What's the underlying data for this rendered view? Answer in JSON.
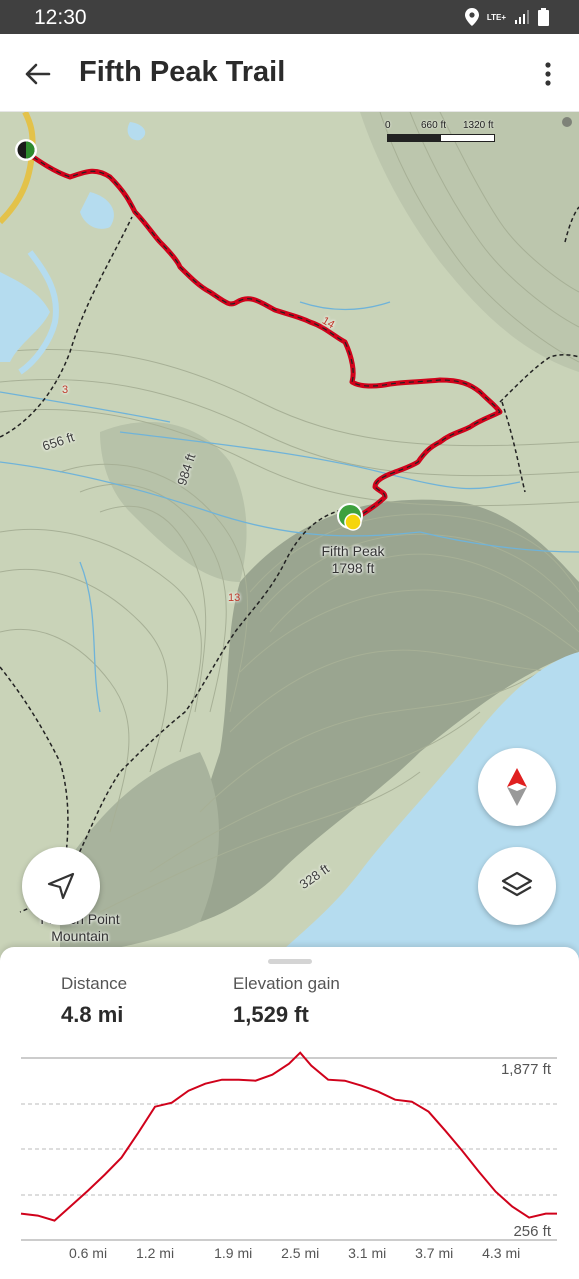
{
  "status_bar": {
    "time": "12:30",
    "network": "LTE+"
  },
  "app_bar": {
    "title": "Fifth Peak Trail"
  },
  "map": {
    "scale": {
      "zero": "0",
      "mid": "660 ft",
      "end": "1320 ft"
    },
    "peak": {
      "name": "Fifth Peak",
      "elevation": "1798 ft"
    },
    "place": {
      "name": "French Point Mountain"
    },
    "contour_labels": [
      "656 ft",
      "984 ft",
      "328 ft"
    ],
    "trail_numbers": [
      "3",
      "14",
      "13"
    ],
    "colors": {
      "trail": "#d0021b",
      "water": "#b5dcef",
      "terrain": "#c8d2b6"
    }
  },
  "stats": [
    {
      "label": "Distance",
      "value": "4.8 mi"
    },
    {
      "label": "Elevation gain",
      "value": "1,529 ft"
    }
  ],
  "chart_data": {
    "type": "line",
    "x_tick_labels": [
      "0.6 mi",
      "1.2 mi",
      "1.9 mi",
      "2.5 mi",
      "3.1 mi",
      "3.7 mi",
      "4.3 mi"
    ],
    "y_tick_labels": [
      "1,877 ft",
      "256 ft"
    ],
    "ylim": [
      256,
      1877
    ],
    "xlim": [
      0,
      4.8
    ],
    "series": [
      {
        "x": [
          0,
          0.15,
          0.3,
          0.45,
          0.6,
          0.75,
          0.9,
          1.05,
          1.2,
          1.35,
          1.5,
          1.65,
          1.8,
          1.95,
          2.1,
          2.25,
          2.4,
          2.5,
          2.6,
          2.75,
          2.9,
          3.05,
          3.2,
          3.35,
          3.5,
          3.65,
          3.8,
          3.95,
          4.1,
          4.25,
          4.4,
          4.55,
          4.7,
          4.8
        ],
        "y": [
          400,
          380,
          330,
          480,
          630,
          790,
          960,
          1210,
          1470,
          1510,
          1630,
          1700,
          1740,
          1740,
          1730,
          1790,
          1900,
          2010,
          1880,
          1740,
          1730,
          1680,
          1620,
          1540,
          1520,
          1420,
          1230,
          1030,
          820,
          620,
          470,
          360,
          400,
          400
        ]
      }
    ],
    "grid": true,
    "color": "#d0021b"
  }
}
